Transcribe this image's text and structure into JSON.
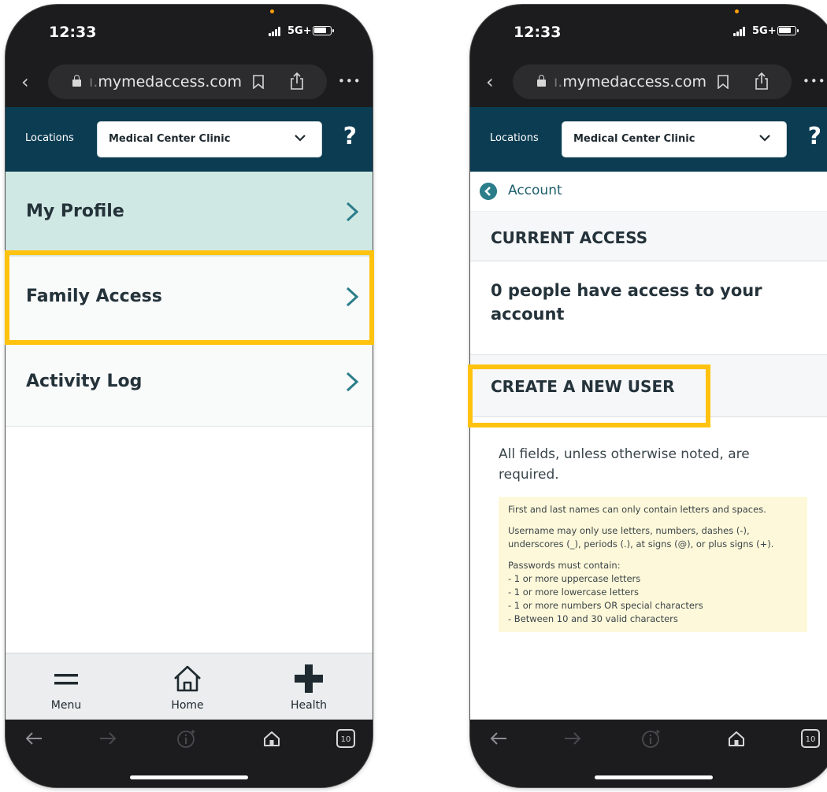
{
  "colors": {
    "header_teal": "#0b3c52",
    "active_row": "#d0e8e4",
    "highlight": "#ffc20e",
    "arrow": "#2c7d8a",
    "rules_bg": "#fdf8d9"
  },
  "status_bar": {
    "time": "12:33",
    "network": "5G+"
  },
  "browser": {
    "url_prefix": "ı.",
    "url_domain": "mymedaccess.com",
    "more_label": "•••"
  },
  "location_bar": {
    "label": "Locations",
    "selected": "Medical Center Clinic",
    "help": "?"
  },
  "left_screen": {
    "menu_items": [
      {
        "label": "My Profile",
        "active": true
      },
      {
        "label": "Family Access",
        "highlighted": true
      },
      {
        "label": "Activity Log"
      }
    ],
    "bottom_nav": [
      {
        "label": "Menu",
        "icon": "hamburger-icon"
      },
      {
        "label": "Home",
        "icon": "home-icon"
      },
      {
        "label": "Health",
        "icon": "plus-icon"
      }
    ]
  },
  "right_screen": {
    "back_label": "Account",
    "current_access_heading": "CURRENT ACCESS",
    "access_summary": "0 people have access to your account",
    "create_user_heading": "CREATE A NEW USER",
    "fields_note": "All fields, unless otherwise noted, are required.",
    "rules": {
      "names": "First and last names can only contain letters and spaces.",
      "username": "Username may only use letters, numbers, dashes (-), underscores (_), periods (.), at signs (@), or plus signs (+).",
      "password_intro": "Passwords must contain:",
      "password_items": [
        "- 1 or more uppercase letters",
        "- 1 or more lowercase letters",
        "- 1 or more numbers OR special characters",
        "- Between 10 and 30 valid characters"
      ]
    }
  },
  "toolbar": {
    "tab_count": "10"
  }
}
